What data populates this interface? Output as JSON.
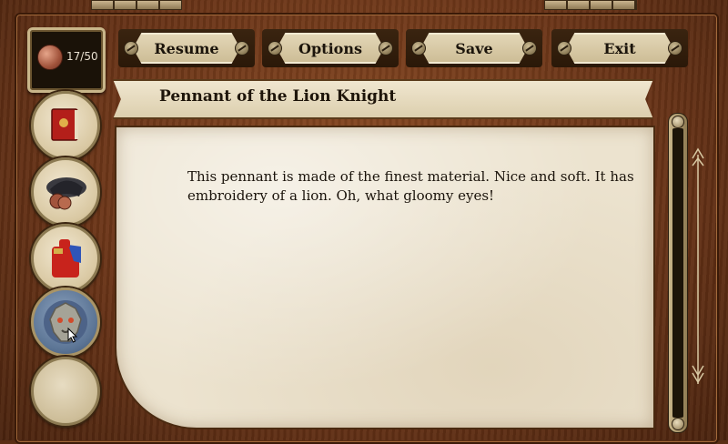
{
  "hud": {
    "coin_count": "17/50"
  },
  "menu": {
    "resume_label": "Resume",
    "options_label": "Options",
    "save_label": "Save",
    "exit_label": "Exit"
  },
  "sidebar": {
    "tabs": [
      {
        "icon": "book-icon",
        "active": false
      },
      {
        "icon": "hat-icon",
        "active": false
      },
      {
        "icon": "uniform-icon",
        "active": false
      },
      {
        "icon": "lion-icon",
        "active": true
      },
      {
        "icon": "empty-slot",
        "active": false
      }
    ]
  },
  "item": {
    "title": "Pennant of the Lion Knight",
    "description": "This pennant is made of the finest material. Nice and soft. It has embroidery of a lion. Oh, what gloomy eyes!"
  },
  "colors": {
    "frame_wood": "#6b3518",
    "parchment": "#ece3cf",
    "button_plate": "#dccfae",
    "text": "#1a130b"
  }
}
